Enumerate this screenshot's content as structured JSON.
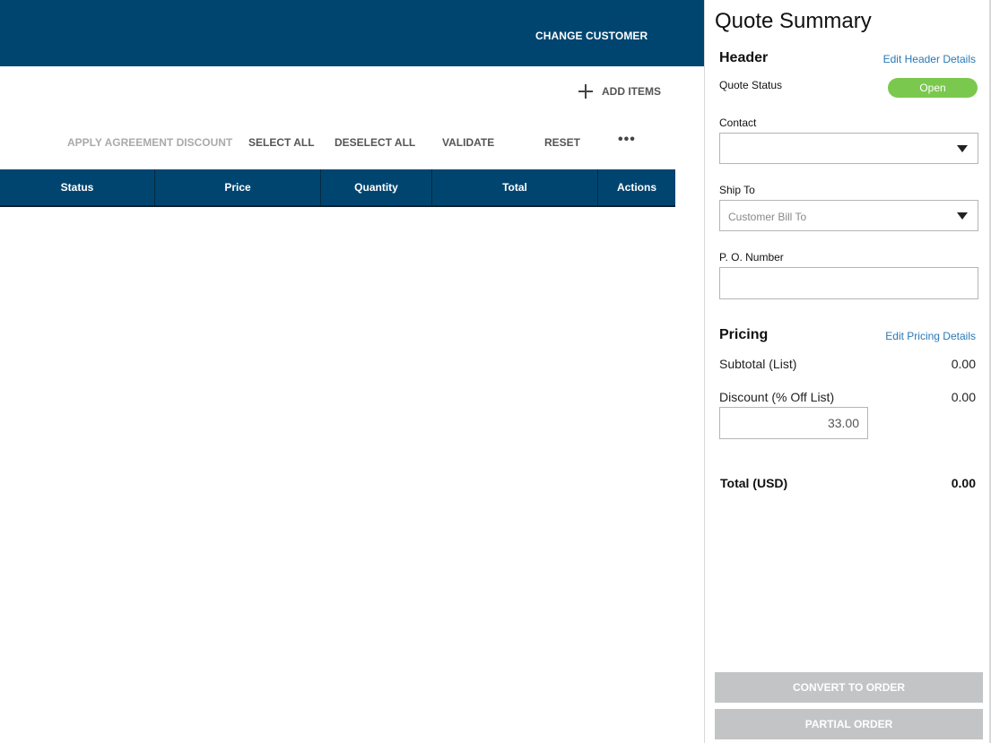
{
  "header": {
    "change_customer_label": "CHANGE CUSTOMER"
  },
  "toolbar": {
    "add_items_label": "ADD ITEMS",
    "apply_agreement_discount_label": "APPLY AGREEMENT DISCOUNT",
    "select_all_label": "SELECT ALL",
    "deselect_all_label": "DESELECT ALL",
    "validate_label": "VALIDATE",
    "reset_label": "RESET",
    "more_label": "•••"
  },
  "table": {
    "columns": [
      "Status",
      "Price",
      "Quantity",
      "Total",
      "Actions"
    ]
  },
  "summary": {
    "title": "Quote Summary",
    "header_section": {
      "heading": "Header",
      "edit_link": "Edit Header Details",
      "quote_status_label": "Quote Status",
      "quote_status_value": "Open",
      "contact_label": "Contact",
      "contact_value": "",
      "ship_to_label": "Ship To",
      "ship_to_value": "Customer Bill To",
      "po_number_label": "P. O. Number",
      "po_number_value": ""
    },
    "pricing_section": {
      "heading": "Pricing",
      "edit_link": "Edit Pricing Details",
      "subtotal_label": "Subtotal (List)",
      "subtotal_value": "0.00",
      "discount_label": "Discount (% Off List)",
      "discount_value": "0.00",
      "discount_input_value": "33.00",
      "total_label": "Total (USD)",
      "total_value": "0.00"
    },
    "buttons": {
      "convert_to_order": "CONVERT TO ORDER",
      "partial_order": "PARTIAL ORDER"
    }
  },
  "colors": {
    "primary": "#004570",
    "status_open": "#7bc84e",
    "link": "#2a78b5",
    "disabled_button": "#c3c4c6"
  }
}
